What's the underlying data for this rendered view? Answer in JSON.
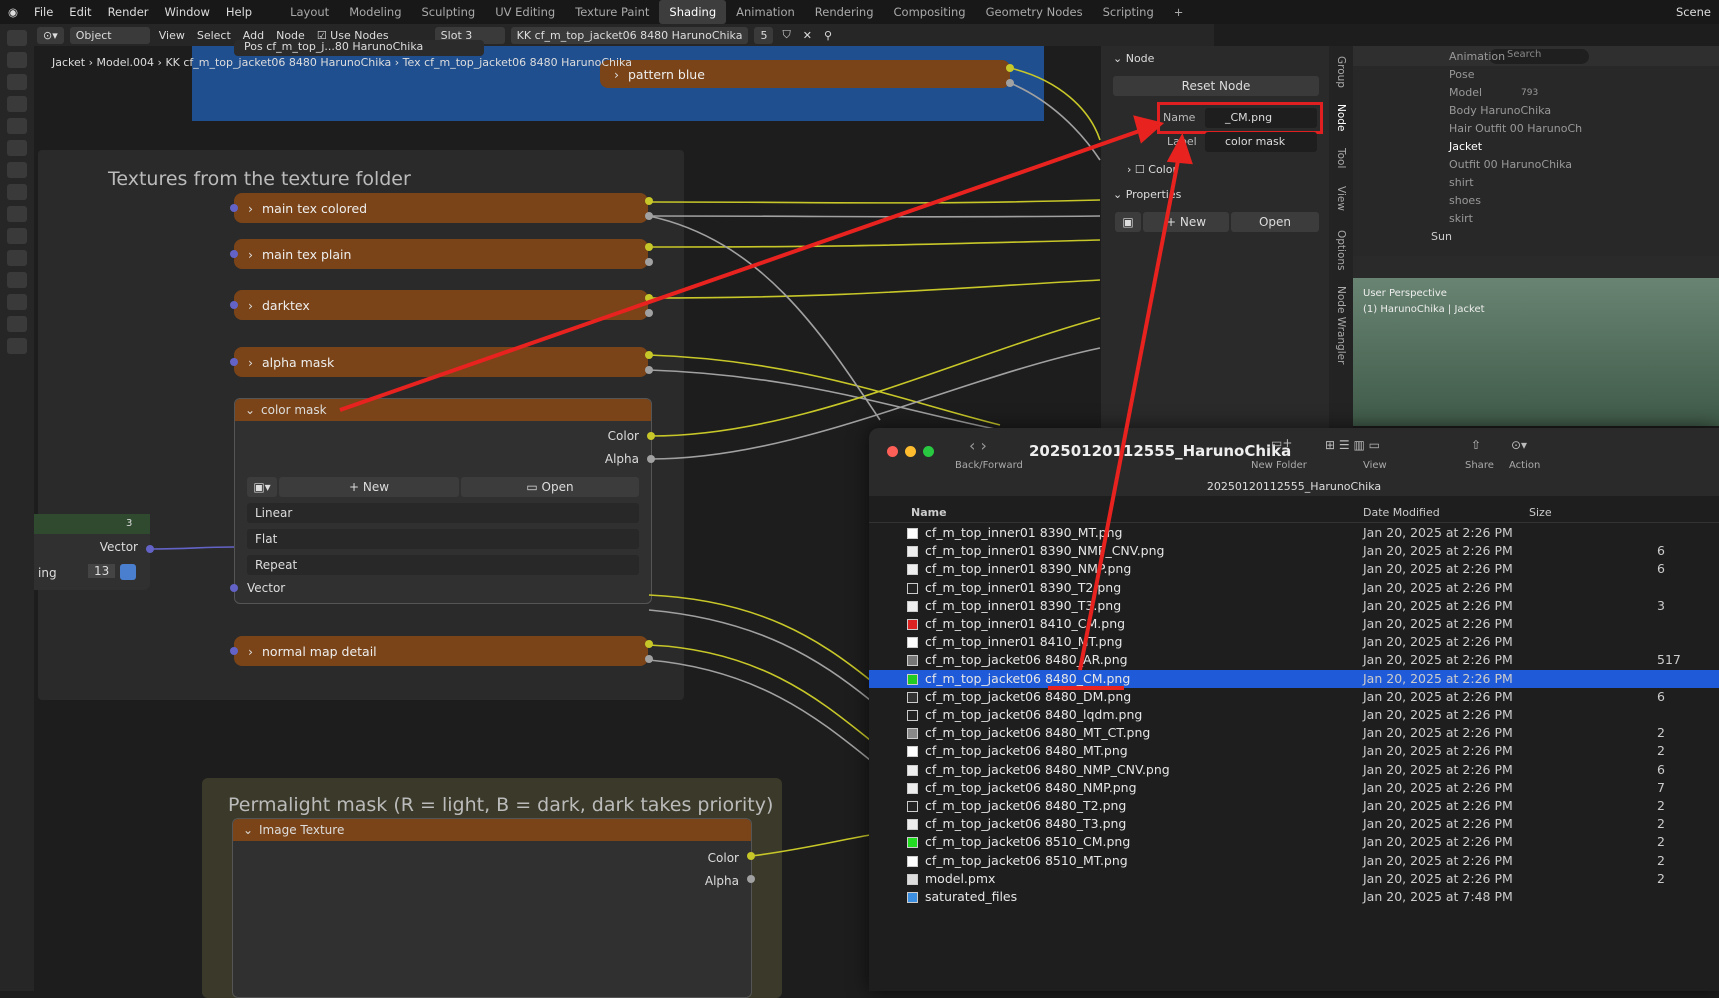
{
  "menu": [
    "File",
    "Edit",
    "Render",
    "Window",
    "Help"
  ],
  "workspaces": [
    "Layout",
    "Modeling",
    "Sculpting",
    "UV Editing",
    "Texture Paint",
    "Shading",
    "Animation",
    "Rendering",
    "Compositing",
    "Geometry Nodes",
    "Scripting"
  ],
  "active_workspace": "Shading",
  "scene_label": "Scene",
  "header": {
    "mode": "Object",
    "view": "View",
    "select": "Select",
    "add": "Add",
    "node": "Node",
    "use_nodes": "Use Nodes",
    "slot": "Slot 3",
    "material": "KK cf_m_top_jacket06 8480 HarunoChika",
    "users": "5"
  },
  "breadcrumb": [
    "Jacket",
    "Model.004",
    "KK cf_m_top_jacket06 8480 HarunoChika",
    "Tex cf_m_top_jacket06 8480 HarunoChika"
  ],
  "top_node": {
    "title": "Pos cf_m_top_j...80 HarunoChika",
    "pattern": "pattern blue"
  },
  "frame1_title": "Textures from the texture folder",
  "nodes": [
    "main tex colored",
    "main tex plain",
    "darktex",
    "alpha mask",
    "normal map detail"
  ],
  "color_mask_node": {
    "title": "color mask",
    "out_color": "Color",
    "out_alpha": "Alpha",
    "new": "New",
    "open": "Open",
    "interp": "Linear",
    "proj": "Flat",
    "ext": "Repeat",
    "in_vector": "Vector"
  },
  "left_node": {
    "vector": "Vector",
    "ing": "ing",
    "num": "13",
    "badge": "3"
  },
  "frame2_title": "Permalight mask (R = light, B = dark, dark takes priority)",
  "image_texture": {
    "title": "Image Texture",
    "color": "Color",
    "alpha": "Alpha"
  },
  "npanel": {
    "node_header": "Node",
    "reset": "Reset Node",
    "name_label": "Name",
    "name_value": "_CM.png",
    "label_label": "Label",
    "label_value": "color mask",
    "color": "Color",
    "properties": "Properties",
    "new": "New",
    "open": "Open"
  },
  "ntabs": [
    "Group",
    "Node",
    "Tool",
    "View",
    "Options",
    "Node Wrangler"
  ],
  "outliner": {
    "search": "Search",
    "items": [
      "Animation",
      "Pose",
      "Model",
      "Body HarunoChika",
      "Hair Outfit 00 HarunoCh",
      "Jacket",
      "Outfit 00 HarunoChika",
      "shirt",
      "shoes",
      "skirt",
      "Sun"
    ],
    "count": "793"
  },
  "viewport": {
    "line1": "User Perspective",
    "line2": "(1) HarunoChika | Jacket"
  },
  "finder": {
    "title": "20250120112555_HarunoChika",
    "path": "20250120112555_HarunoChika",
    "back": "Back/Forward",
    "newfolder": "New Folder",
    "view": "View",
    "share": "Share",
    "action": "Action",
    "col_name": "Name",
    "col_date": "Date Modified",
    "col_size": "Size",
    "rows": [
      {
        "name": "cf_m_top_inner01 8390_MT.png",
        "date": "Jan 20, 2025 at 2:26 PM",
        "size": "",
        "icon": "#ffffff"
      },
      {
        "name": "cf_m_top_inner01 8390_NMP_CNV.png",
        "date": "Jan 20, 2025 at 2:26 PM",
        "size": "6",
        "icon": "#eeeeee"
      },
      {
        "name": "cf_m_top_inner01 8390_NMP.png",
        "date": "Jan 20, 2025 at 2:26 PM",
        "size": "6",
        "icon": "#eeeeee"
      },
      {
        "name": "cf_m_top_inner01 8390_T2.png",
        "date": "Jan 20, 2025 at 2:26 PM",
        "size": "",
        "icon": "#222222"
      },
      {
        "name": "cf_m_top_inner01 8390_T3.png",
        "date": "Jan 20, 2025 at 2:26 PM",
        "size": "3",
        "icon": "#eeeeee"
      },
      {
        "name": "cf_m_top_inner01 8410_CM.png",
        "date": "Jan 20, 2025 at 2:26 PM",
        "size": "",
        "icon": "#dd2222"
      },
      {
        "name": "cf_m_top_inner01 8410_MT.png",
        "date": "Jan 20, 2025 at 2:26 PM",
        "size": "",
        "icon": "#ffffff"
      },
      {
        "name": "cf_m_top_jacket06 8480_AR.png",
        "date": "Jan 20, 2025 at 2:26 PM",
        "size": "517",
        "icon": "#777777"
      },
      {
        "name": "cf_m_top_jacket06 8480_CM.png",
        "date": "Jan 20, 2025 at 2:26 PM",
        "size": "",
        "icon": "#22cc22"
      },
      {
        "name": "cf_m_top_jacket06 8480_DM.png",
        "date": "Jan 20, 2025 at 2:26 PM",
        "size": "6",
        "icon": "#333333"
      },
      {
        "name": "cf_m_top_jacket06 8480_lqdm.png",
        "date": "Jan 20, 2025 at 2:26 PM",
        "size": "",
        "icon": "#222222"
      },
      {
        "name": "cf_m_top_jacket06 8480_MT_CT.png",
        "date": "Jan 20, 2025 at 2:26 PM",
        "size": "2",
        "icon": "#888888"
      },
      {
        "name": "cf_m_top_jacket06 8480_MT.png",
        "date": "Jan 20, 2025 at 2:26 PM",
        "size": "2",
        "icon": "#ffffff"
      },
      {
        "name": "cf_m_top_jacket06 8480_NMP_CNV.png",
        "date": "Jan 20, 2025 at 2:26 PM",
        "size": "6",
        "icon": "#eeeeee"
      },
      {
        "name": "cf_m_top_jacket06 8480_NMP.png",
        "date": "Jan 20, 2025 at 2:26 PM",
        "size": "7",
        "icon": "#eeeeee"
      },
      {
        "name": "cf_m_top_jacket06 8480_T2.png",
        "date": "Jan 20, 2025 at 2:26 PM",
        "size": "2",
        "icon": "#222222"
      },
      {
        "name": "cf_m_top_jacket06 8480_T3.png",
        "date": "Jan 20, 2025 at 2:26 PM",
        "size": "2",
        "icon": "#eeeeee"
      },
      {
        "name": "cf_m_top_jacket06 8510_CM.png",
        "date": "Jan 20, 2025 at 2:26 PM",
        "size": "2",
        "icon": "#22dd22"
      },
      {
        "name": "cf_m_top_jacket06 8510_MT.png",
        "date": "Jan 20, 2025 at 2:26 PM",
        "size": "2",
        "icon": "#ffffff"
      },
      {
        "name": "model.pmx",
        "date": "Jan 20, 2025 at 2:26 PM",
        "size": "2",
        "icon": "#dddddd"
      },
      {
        "name": "saturated_files",
        "date": "Jan 20, 2025 at 7:48 PM",
        "size": "",
        "icon": "#3b8ee0"
      }
    ],
    "selected_index": 8
  }
}
